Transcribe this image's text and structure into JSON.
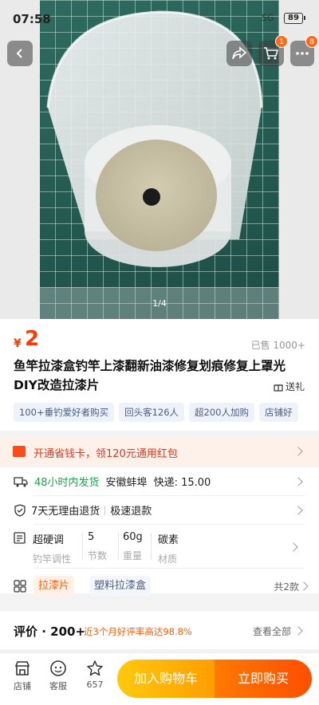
{
  "status_bar": {
    "time": "07:58",
    "signal": "5G",
    "battery": "89"
  },
  "nav": {
    "cart_badge": "1",
    "more_badge": "8"
  },
  "gallery": {
    "pager": "1/4"
  },
  "product": {
    "price_symbol": "¥",
    "price": "2",
    "sold": "已售 1000+",
    "title": "鱼竿拉漆盒钓竿上漆翻新油漆修复划痕修复上罩光DIY改造拉漆片",
    "gift": "送礼",
    "tags": [
      "100+垂钓爱好者购买",
      "回头客126人",
      "超200人加购",
      "店铺好"
    ]
  },
  "promo": {
    "text": "开通省钱卡，领120元通用红包"
  },
  "service": {
    "ship_time": "48小时内发货",
    "ship_from": "安徽蚌埠",
    "ship_fee": "快递: 15.00",
    "return_policy": "7天无理由退货",
    "refund": "极速退款"
  },
  "params": [
    {
      "value": "超硬调",
      "label": "钓竿调性"
    },
    {
      "value": "5",
      "label": "节数"
    },
    {
      "value": "60g",
      "label": "重量"
    },
    {
      "value": "碳素",
      "label": "材质"
    }
  ],
  "sku": {
    "options": [
      "拉漆片",
      "塑料拉漆盒"
    ],
    "count": "共2款"
  },
  "reviews": {
    "title": "评价 · 200+",
    "rate": "近3个月好评率高达98.8%",
    "view_all": "查看全部"
  },
  "bottom_bar": {
    "shop": "店铺",
    "service": "客服",
    "favorites": "657",
    "add_to_cart": "加入购物车",
    "buy_now": "立即购买"
  },
  "colors": {
    "accent": "#ff5a00",
    "price": "#ff3a00",
    "green": "#1aa34a",
    "cart_button": "#ffb400",
    "buy_button": "#ff5a00"
  }
}
